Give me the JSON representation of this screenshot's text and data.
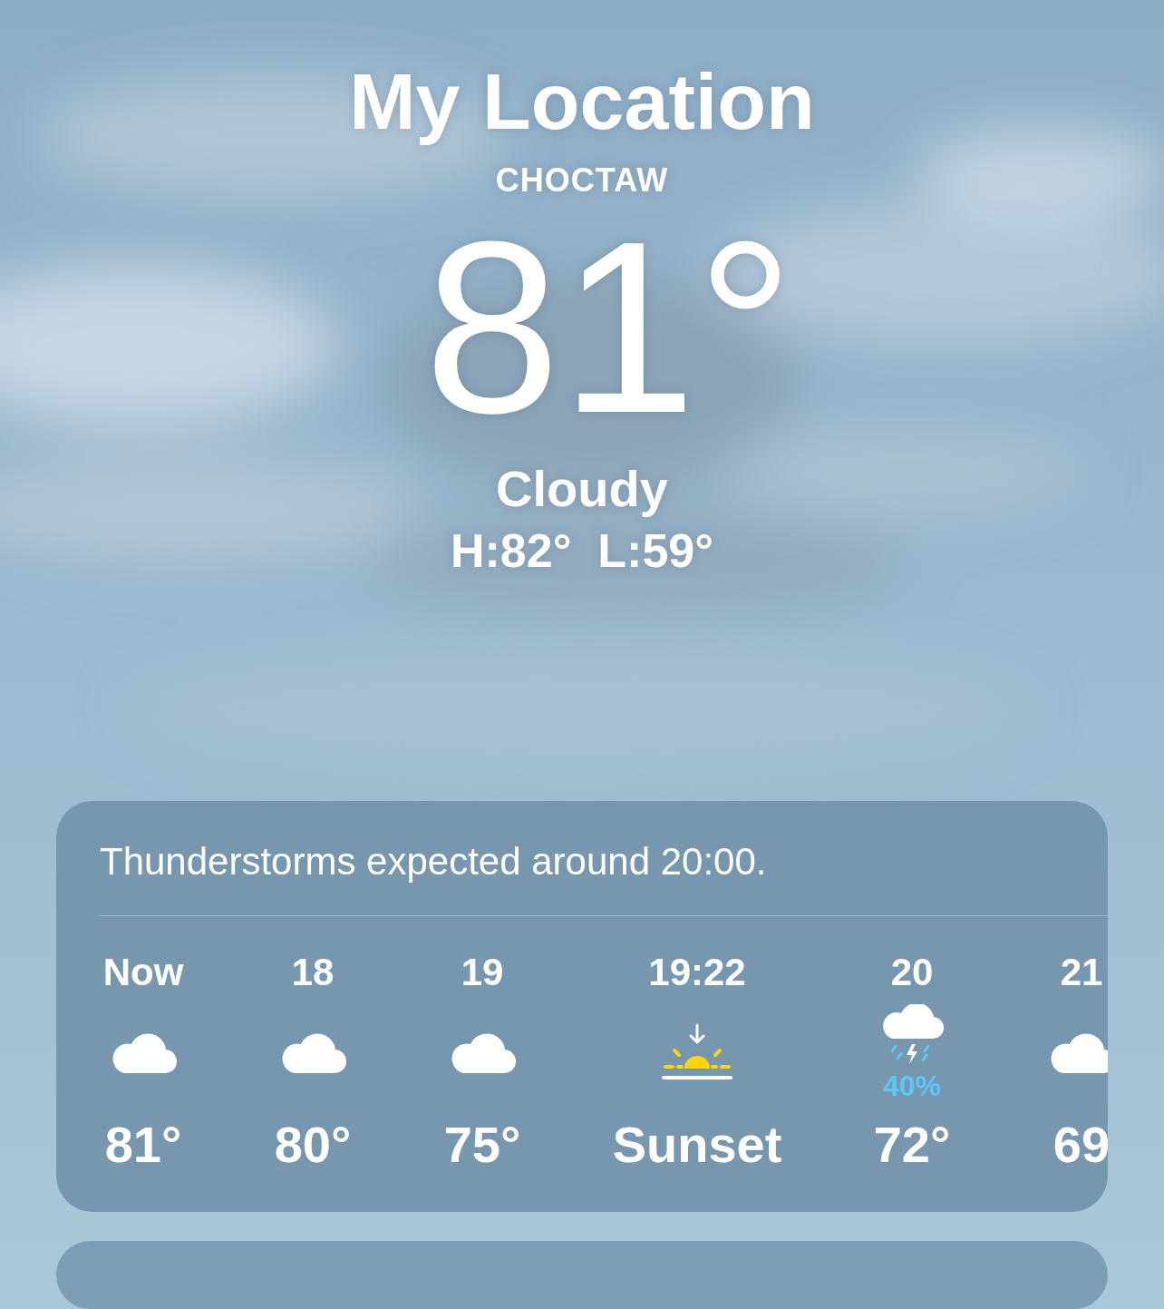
{
  "location": {
    "title": "My Location",
    "place": "CHOCTAW",
    "temperature": "81°",
    "condition": "Cloudy",
    "high_low": "H:82°  L:59°"
  },
  "hourly": {
    "summary": "Thunderstorms expected around 20:00.",
    "items": [
      {
        "kind": "cloudy",
        "label": "Now",
        "temp": "81°"
      },
      {
        "kind": "cloudy",
        "label": "18",
        "temp": "80°"
      },
      {
        "kind": "cloudy",
        "label": "19",
        "temp": "75°"
      },
      {
        "kind": "sunset",
        "label": "19:22",
        "temp": "Sunset"
      },
      {
        "kind": "thunderstorm",
        "label": "20",
        "precip": "40%",
        "temp": "72°"
      },
      {
        "kind": "cloudy",
        "label": "21",
        "temp": "69"
      }
    ]
  }
}
